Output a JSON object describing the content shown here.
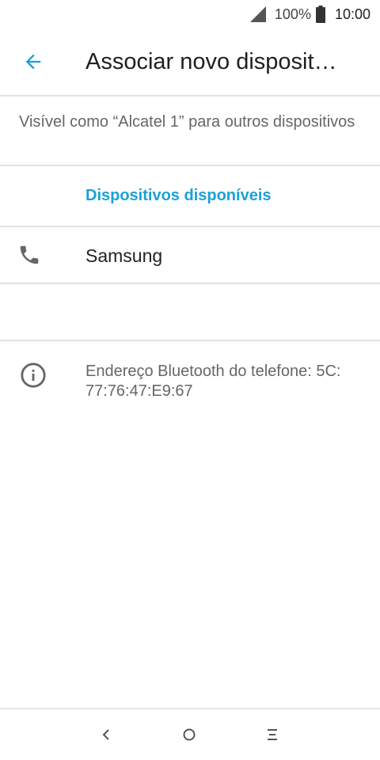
{
  "status_bar": {
    "battery_percent": "100%",
    "time": "10:00",
    "signal_icon": "cell-signal-icon",
    "battery_icon": "battery-full-icon"
  },
  "app_bar": {
    "back_icon": "arrow-back-icon",
    "title": "Associar novo disposit…",
    "accent_color": "#1ba1d8"
  },
  "visibility_text": "Visível como “Alcatel 1” para outros dispositivos",
  "section_header": "Dispositivos disponíveis",
  "devices": [
    {
      "name": "Samsung",
      "icon": "phone-icon"
    }
  ],
  "info": {
    "icon": "info-icon",
    "text": "Endereço Bluetooth do telefone: 5C: 77:76:47:E9:67"
  },
  "nav_bar": {
    "back_icon": "nav-back-icon",
    "home_icon": "nav-home-icon",
    "recent_icon": "nav-recent-icon"
  }
}
